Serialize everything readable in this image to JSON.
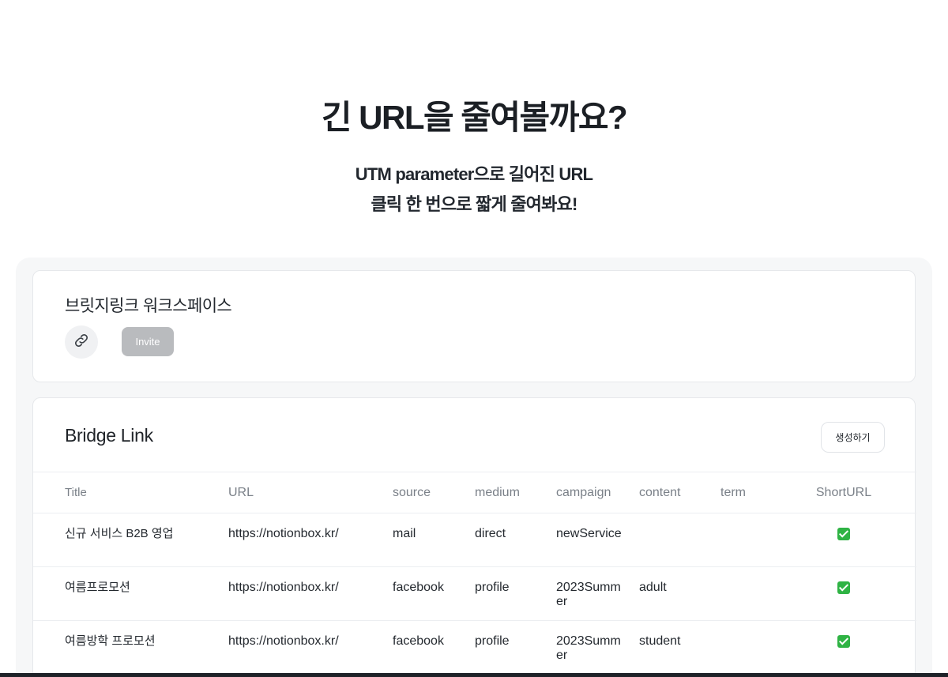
{
  "hero": {
    "title": "긴 URL을 줄여볼까요?",
    "subtitle_line1": "UTM parameter으로 길어진 URL",
    "subtitle_line2": "클릭 한 번으로 짧게 줄여봐요!"
  },
  "workspace": {
    "title": "브릿지링크 워크스페이스",
    "link_icon": "link-icon",
    "invite_label": "Invite"
  },
  "bridge_link": {
    "title": "Bridge Link",
    "create_label": "생성하기",
    "columns": [
      "Title",
      "URL",
      "source",
      "medium",
      "campaign",
      "content",
      "term",
      "ShortURL"
    ],
    "rows": [
      {
        "title": "신규 서비스 B2B 영업",
        "url": "https://notionbox.kr/",
        "source": "mail",
        "medium": "direct",
        "campaign": "newService",
        "content": "",
        "term": "",
        "short": true
      },
      {
        "title": "여름프로모션",
        "url": "https://notionbox.kr/",
        "source": "facebook",
        "medium": "profile",
        "campaign": "2023Summer",
        "content": "adult",
        "term": "",
        "short": true
      },
      {
        "title": "여름방학 프로모션",
        "url": "https://notionbox.kr/",
        "source": "facebook",
        "medium": "profile",
        "campaign": "2023Summer",
        "content": "student",
        "term": "",
        "short": true
      }
    ]
  },
  "colors": {
    "check_green": "#2fb344",
    "invite_disabled": "#b9bbbe",
    "panel_bg": "#f6f7f8"
  }
}
